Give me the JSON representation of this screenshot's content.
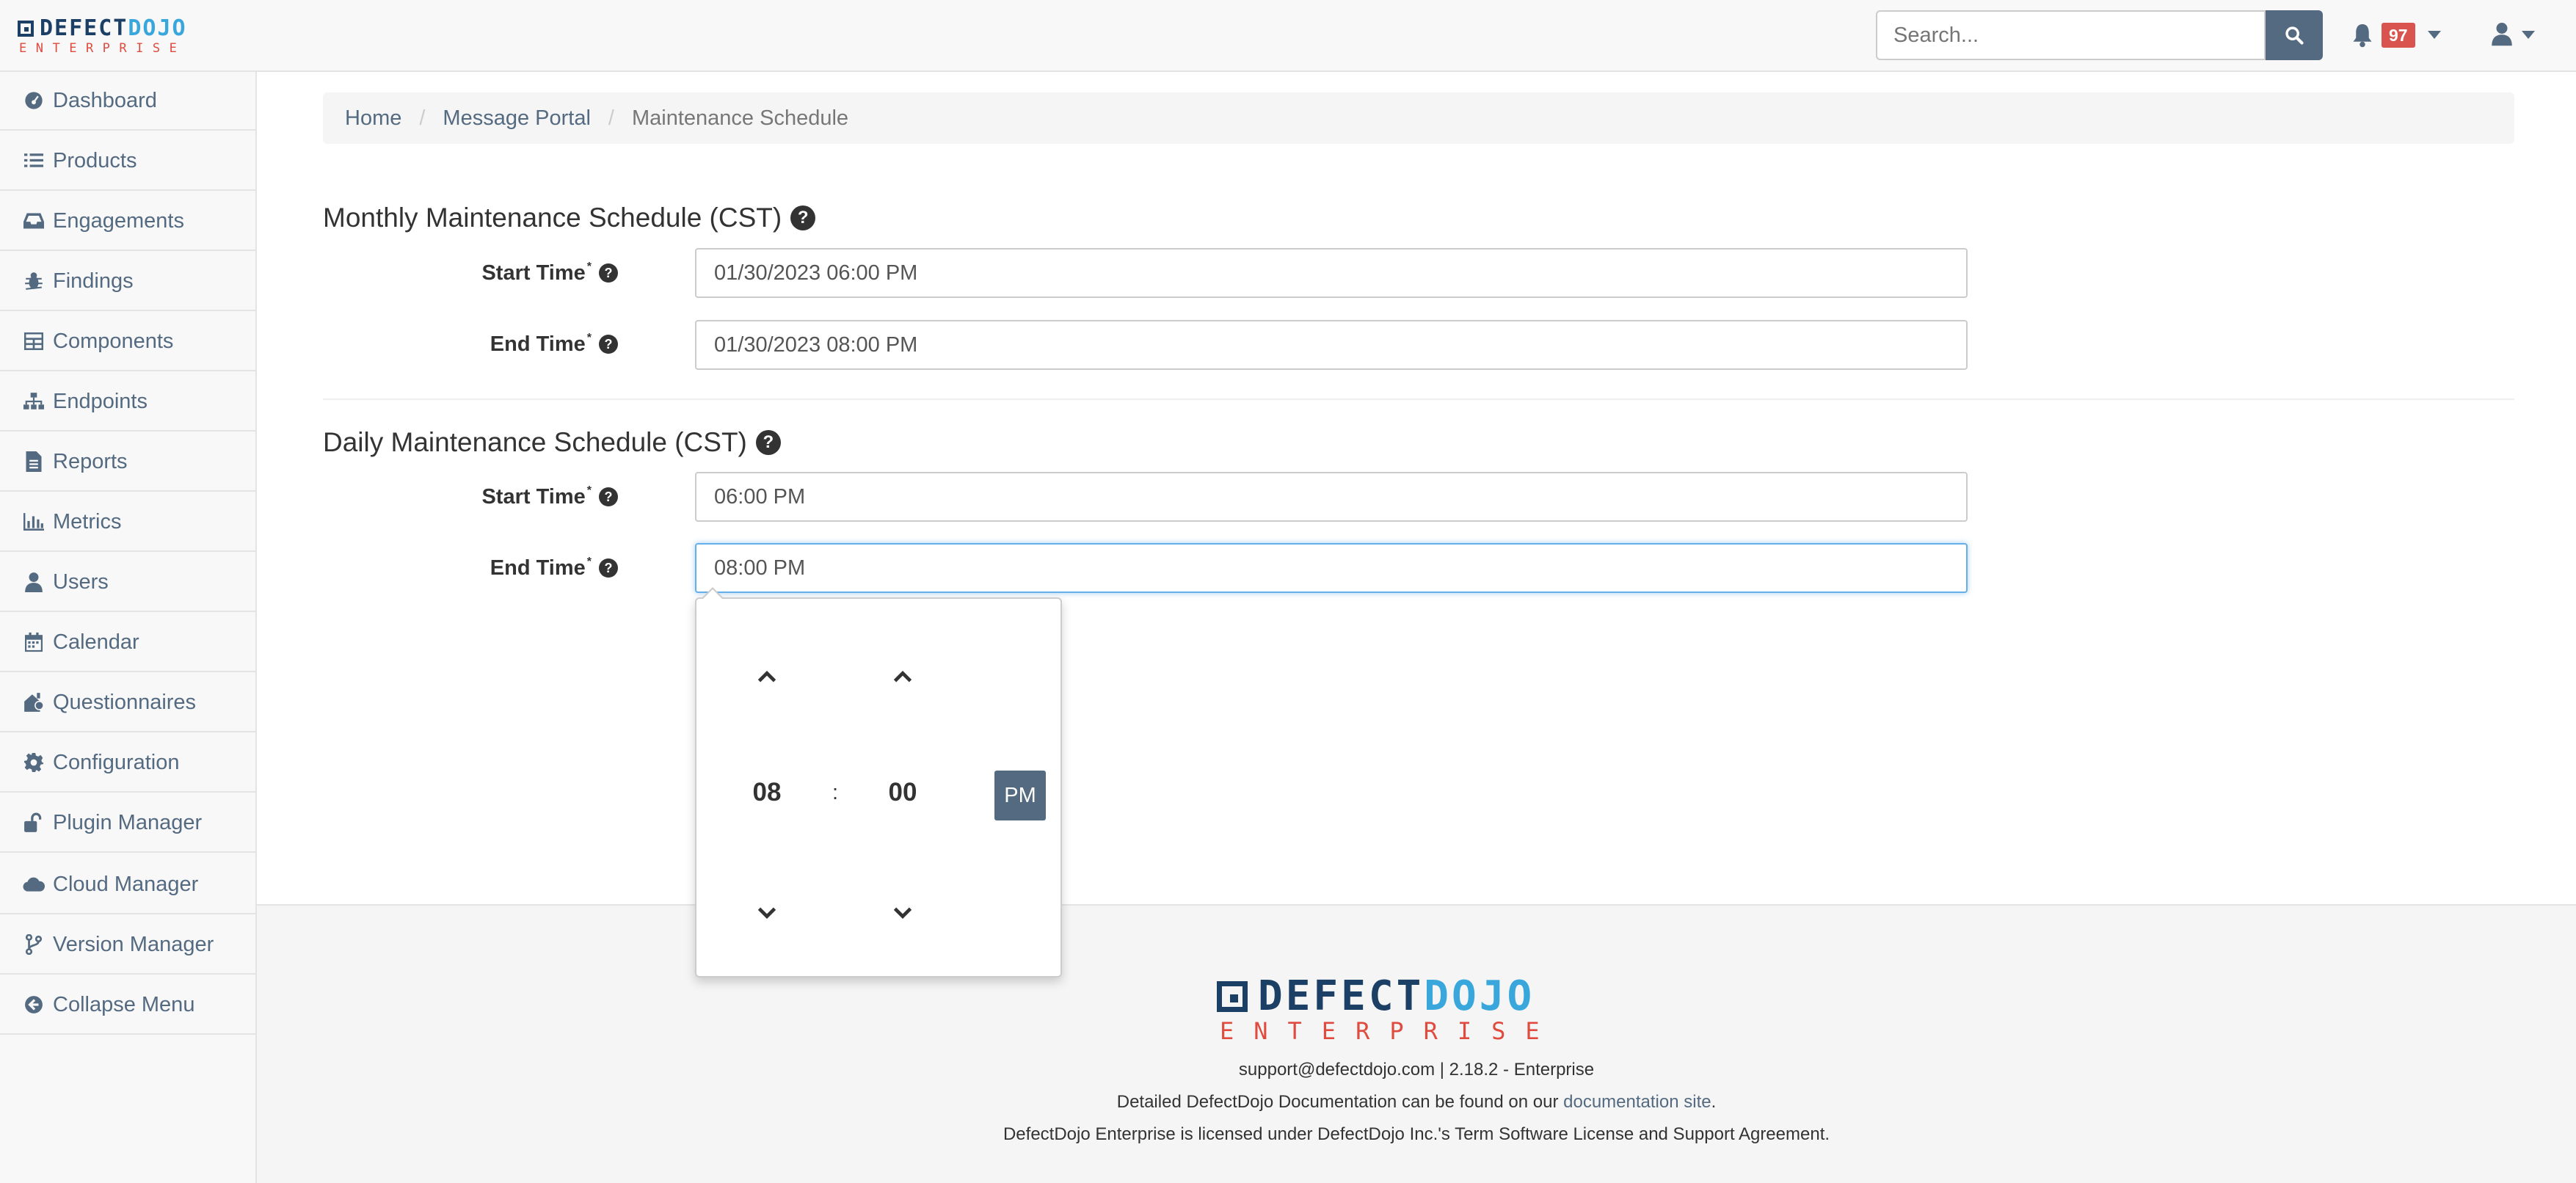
{
  "brand": {
    "word1": "DEFECT",
    "word2": "DOJO",
    "sub": "ENTERPRISE"
  },
  "header": {
    "search_placeholder": "Search...",
    "notification_count": "97"
  },
  "sidebar": {
    "items": [
      {
        "label": "Dashboard",
        "icon": "dashboard-icon"
      },
      {
        "label": "Products",
        "icon": "list-icon"
      },
      {
        "label": "Engagements",
        "icon": "inbox-icon"
      },
      {
        "label": "Findings",
        "icon": "bug-icon"
      },
      {
        "label": "Components",
        "icon": "table-icon"
      },
      {
        "label": "Endpoints",
        "icon": "sitemap-icon"
      },
      {
        "label": "Reports",
        "icon": "file-icon"
      },
      {
        "label": "Metrics",
        "icon": "chart-icon"
      },
      {
        "label": "Users",
        "icon": "user-icon"
      },
      {
        "label": "Calendar",
        "icon": "calendar-icon"
      },
      {
        "label": "Questionnaires",
        "icon": "questionnaire-icon"
      },
      {
        "label": "Configuration",
        "icon": "gear-icon"
      },
      {
        "label": "Plugin Manager",
        "icon": "unlock-icon"
      },
      {
        "label": "Cloud Manager",
        "icon": "cloud-icon"
      },
      {
        "label": "Version Manager",
        "icon": "branch-icon"
      },
      {
        "label": "Collapse Menu",
        "icon": "arrow-circle-left-icon"
      }
    ]
  },
  "breadcrumb": {
    "home": "Home",
    "parent": "Message Portal",
    "current": "Maintenance Schedule"
  },
  "monthly": {
    "title": "Monthly Maintenance Schedule (CST)",
    "start_label": "Start Time",
    "start_value": "01/30/2023 06:00 PM",
    "end_label": "End Time",
    "end_value": "01/30/2023 08:00 PM"
  },
  "daily": {
    "title": "Daily Maintenance Schedule (CST)",
    "start_label": "Start Time",
    "start_value": "06:00 PM",
    "end_label": "End Time",
    "end_value": "08:00 PM"
  },
  "required_marker": "*",
  "help_glyph": "?",
  "timepicker": {
    "hour": "08",
    "separator": ":",
    "minute": "00",
    "period": "PM"
  },
  "footer": {
    "contact": "support@defectdojo.com | 2.18.2 - Enterprise",
    "docs_prefix": "Detailed DefectDojo Documentation can be found on our ",
    "docs_link": "documentation site",
    "docs_suffix": ".",
    "license": "DefectDojo Enterprise is licensed under DefectDojo Inc.'s Term Software License and Support Agreement."
  },
  "colors": {
    "accent": "#546a81",
    "badge": "#d9534f",
    "brand_dark": "#1c3f66",
    "brand_light": "#3aa7dc",
    "brand_red": "#e04b3f"
  }
}
